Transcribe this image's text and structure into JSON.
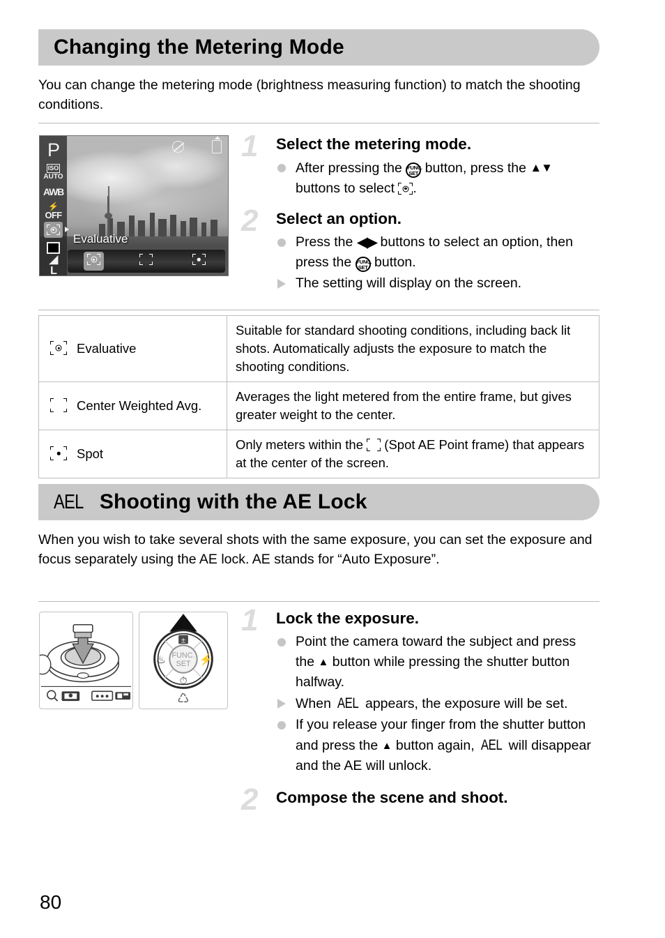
{
  "page": {
    "number": "80"
  },
  "section1": {
    "heading": "Changing the Metering Mode",
    "intro": "You can change the metering mode (brightness measuring function) to match the shooting conditions.",
    "lcd": {
      "mode_label": "P",
      "iso_top": "ISO",
      "iso_bottom": "AUTO",
      "white_balance": "AWB",
      "flash": "OFF",
      "quality": "L",
      "setting_name": "Evaluative",
      "options": [
        "Evaluative",
        "Center Weighted Avg.",
        "Spot"
      ],
      "selected_option": "Evaluative"
    },
    "steps": [
      {
        "number": "1",
        "title": "Select the metering mode.",
        "lines": [
          {
            "marker": "dot",
            "pre": "After pressing the ",
            "glyph": "func-set",
            "mid": " button, press the ",
            "glyph2": "up-down",
            "post": " buttons to select ",
            "glyph3": "evaluative-frame",
            "end": "."
          }
        ]
      },
      {
        "number": "2",
        "title": "Select an option.",
        "lines": [
          {
            "marker": "dot",
            "pre": "Press the ",
            "glyph": "left-right",
            "mid": " buttons to select an option, then press the ",
            "glyph2": "func-set",
            "post": " button."
          },
          {
            "marker": "triangle",
            "pre": "The setting will display on the screen."
          }
        ]
      }
    ],
    "table": {
      "rows": [
        {
          "icon": "evaluative-frame",
          "label": "Evaluative",
          "description": "Suitable for standard shooting conditions, including back lit shots. Automatically adjusts the exposure to match the shooting conditions."
        },
        {
          "icon": "center-weighted-frame",
          "label": "Center Weighted Avg.",
          "description": "Averages the light metered from the entire frame, but gives greater weight to the center."
        },
        {
          "icon": "spot-frame",
          "label": "Spot",
          "desc_pre": "Only meters within the ",
          "desc_glyph": "empty-frame",
          "desc_post": " (Spot AE Point frame) that appears at the center of the screen."
        }
      ]
    }
  },
  "section2": {
    "heading_icon": "AEL",
    "heading": "Shooting with the AE Lock",
    "intro": "When you wish to take several shots with the same exposure, you can set the exposure and focus separately using the AE lock. AE stands for “Auto Exposure”.",
    "figures": {
      "shutter_caption": "shutter-button-press-diagram",
      "dial_caption": "control-dial-diagram",
      "dial_center_top": "FUNC.",
      "dial_center_bottom": "SET"
    },
    "steps": [
      {
        "number": "1",
        "title": "Lock the exposure.",
        "lines": [
          {
            "marker": "dot",
            "pre": "Point the camera toward the subject and press the ",
            "glyph": "up-arrow",
            "post": " button while pressing the shutter button halfway."
          },
          {
            "marker": "triangle",
            "pre": "When ",
            "glyph": "AEL",
            "post": " appears, the exposure will be set."
          },
          {
            "marker": "dot",
            "pre": "If you release your finger from the shutter button and press the ",
            "glyph": "up-arrow",
            "mid": " button again, ",
            "glyph2": "AEL",
            "post": " will disappear and the AE will unlock."
          }
        ]
      },
      {
        "number": "2",
        "title": "Compose the scene and shoot.",
        "lines": []
      }
    ]
  },
  "colors": {
    "heading_bar": "#c9c9c9",
    "step_number": "#dcdcdc",
    "bullet": "#c5c5c5",
    "rule": "#b9b9b9"
  }
}
